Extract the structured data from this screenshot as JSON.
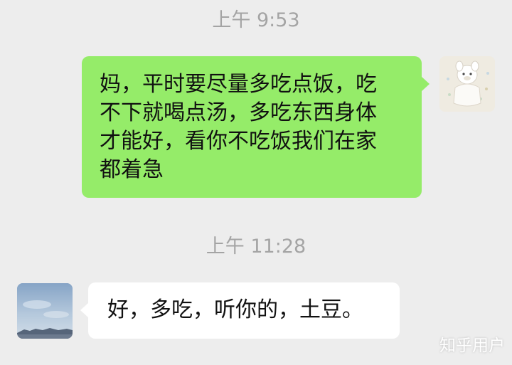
{
  "chat": {
    "messages": [
      {
        "timestamp": "上午 9:53",
        "direction": "sent",
        "text": "妈，平时要尽量多吃点饭，吃\n不下就喝点汤，多吃东西身体\n才能好，看你不吃饭我们在家\n都着急"
      },
      {
        "timestamp": "上午 11:28",
        "direction": "received",
        "text": "好，多吃，听你的，土豆。"
      }
    ]
  },
  "watermark": "知乎用户",
  "colors": {
    "background": "#ededed",
    "sent_bubble": "#95ec69",
    "received_bubble": "#ffffff",
    "timestamp_text": "#a4a4a4"
  }
}
